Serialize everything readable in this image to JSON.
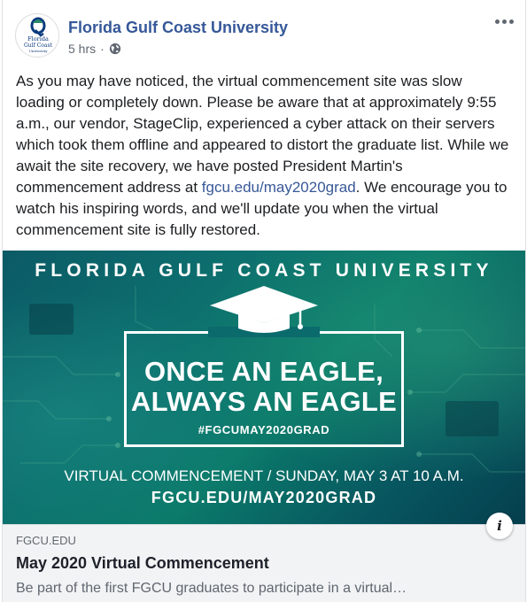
{
  "post": {
    "page_name": "Florida Gulf Coast University",
    "time": "5 hrs",
    "separator": "·",
    "privacy_icon": "globe-icon",
    "more_icon": "more-options-icon",
    "avatar": {
      "line1": "Florida",
      "line2": "Gulf Coast",
      "line3": "University"
    },
    "message_part1": "As you may have noticed, the virtual commencement site was slow loading or completely down. Please be aware that at approximately 9:55 a.m., our vendor, StageClip, experienced a cyber attack on their servers which took them offline and appeared to distort the graduate list. While we await the site recovery, we have posted President Martin's commencement address at ",
    "message_link": "fgcu.edu/may2020grad",
    "message_part2": ". We encourage you to watch his inspiring words, and we'll update you when the virtual commencement site is fully restored."
  },
  "image": {
    "university": "FLORIDA GULF COAST UNIVERSITY",
    "slogan_line1": "ONCE AN EAGLE,",
    "slogan_line2": "ALWAYS AN EAGLE",
    "hashtag": "#FGCUMAY2020GRAD",
    "date_line": "VIRTUAL COMMENCEMENT / SUNDAY, MAY 3 AT 10 A.M.",
    "url": "FGCU.EDU/MAY2020GRAD"
  },
  "link_preview": {
    "domain": "FGCU.EDU",
    "title": "May 2020 Virtual Commencement",
    "description": "Be part of the first FGCU graduates to participate in a virtual…",
    "info_label": "i"
  },
  "colors": {
    "page_name": "#365899",
    "link": "#385898",
    "image_bg": "#0b6b6b"
  }
}
